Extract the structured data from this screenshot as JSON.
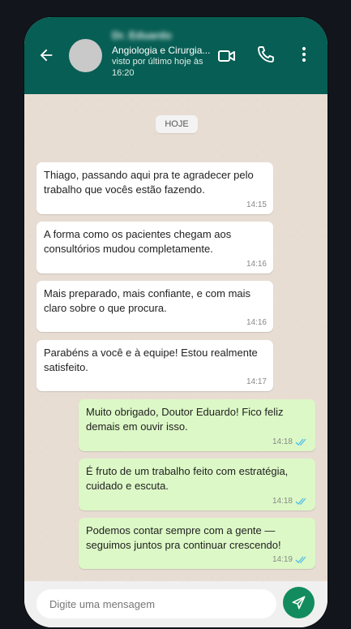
{
  "header": {
    "contact_name": "Dr. Eduardo",
    "contact_subtitle": "Angiologia e Cirurgia...",
    "contact_status": "visto por último hoje às 16:20",
    "icons": [
      "back-arrow-icon",
      "video-camera-icon",
      "phone-icon",
      "more-vertical-icon"
    ]
  },
  "chat": {
    "date_label": "HOJE",
    "messages": [
      {
        "direction": "in",
        "text": "Thiago, passando aqui pra te agradecer pelo trabalho que vocês estão fazendo.",
        "time": "14:15"
      },
      {
        "direction": "in",
        "text": "A forma como os pacientes chegam aos consultórios mudou completamente.",
        "time": "14:16"
      },
      {
        "direction": "in",
        "text": "Mais preparado, mais confiante, e com mais claro sobre o que procura.",
        "time": "14:16"
      },
      {
        "direction": "in",
        "text": "Parabéns a você e à equipe! Estou realmente satisfeito.",
        "time": "14:17"
      },
      {
        "direction": "out",
        "text": "Muito obrigado, Doutor Eduardo! Fico feliz demais em ouvir isso.",
        "time": "14:18",
        "status": "read"
      },
      {
        "direction": "out",
        "text": "É fruto de um trabalho feito com estratégia, cuidado e escuta.",
        "time": "14:18",
        "status": "read"
      },
      {
        "direction": "out",
        "text": "Podemos contar sempre com a gente — seguimos juntos pra continuar crescendo!",
        "time": "14:19",
        "status": "read"
      }
    ]
  },
  "composer": {
    "placeholder": "Digite uma mensagem",
    "value": ""
  },
  "colors": {
    "header_bg": "#075e54",
    "outgoing_bubble": "#dcf8c6",
    "incoming_bubble": "#ffffff",
    "read_ticks": "#53bdeb",
    "send_button": "#128c5e"
  }
}
